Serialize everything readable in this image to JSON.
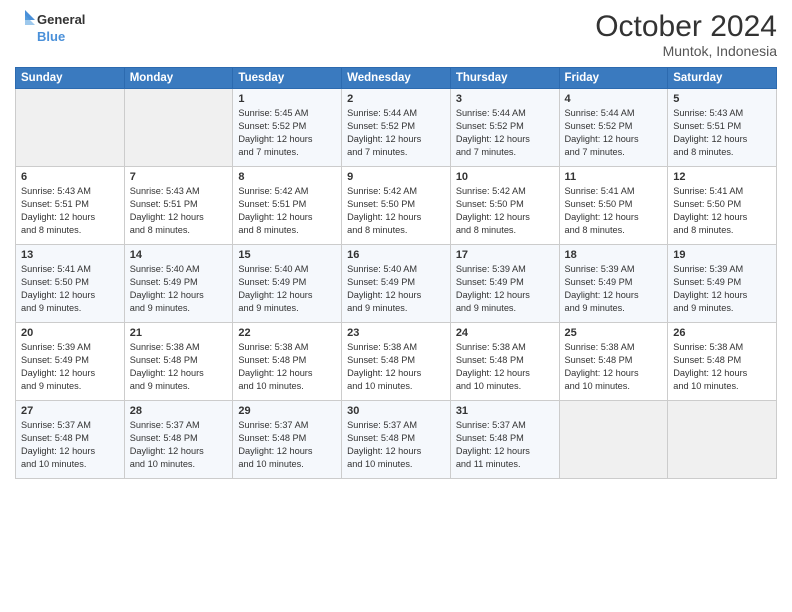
{
  "logo": {
    "line1": "General",
    "line2": "Blue"
  },
  "title": "October 2024",
  "location": "Muntok, Indonesia",
  "days_of_week": [
    "Sunday",
    "Monday",
    "Tuesday",
    "Wednesday",
    "Thursday",
    "Friday",
    "Saturday"
  ],
  "weeks": [
    [
      {
        "day": "",
        "info": ""
      },
      {
        "day": "",
        "info": ""
      },
      {
        "day": "1",
        "info": "Sunrise: 5:45 AM\nSunset: 5:52 PM\nDaylight: 12 hours\nand 7 minutes."
      },
      {
        "day": "2",
        "info": "Sunrise: 5:44 AM\nSunset: 5:52 PM\nDaylight: 12 hours\nand 7 minutes."
      },
      {
        "day": "3",
        "info": "Sunrise: 5:44 AM\nSunset: 5:52 PM\nDaylight: 12 hours\nand 7 minutes."
      },
      {
        "day": "4",
        "info": "Sunrise: 5:44 AM\nSunset: 5:52 PM\nDaylight: 12 hours\nand 7 minutes."
      },
      {
        "day": "5",
        "info": "Sunrise: 5:43 AM\nSunset: 5:51 PM\nDaylight: 12 hours\nand 8 minutes."
      }
    ],
    [
      {
        "day": "6",
        "info": "Sunrise: 5:43 AM\nSunset: 5:51 PM\nDaylight: 12 hours\nand 8 minutes."
      },
      {
        "day": "7",
        "info": "Sunrise: 5:43 AM\nSunset: 5:51 PM\nDaylight: 12 hours\nand 8 minutes."
      },
      {
        "day": "8",
        "info": "Sunrise: 5:42 AM\nSunset: 5:51 PM\nDaylight: 12 hours\nand 8 minutes."
      },
      {
        "day": "9",
        "info": "Sunrise: 5:42 AM\nSunset: 5:50 PM\nDaylight: 12 hours\nand 8 minutes."
      },
      {
        "day": "10",
        "info": "Sunrise: 5:42 AM\nSunset: 5:50 PM\nDaylight: 12 hours\nand 8 minutes."
      },
      {
        "day": "11",
        "info": "Sunrise: 5:41 AM\nSunset: 5:50 PM\nDaylight: 12 hours\nand 8 minutes."
      },
      {
        "day": "12",
        "info": "Sunrise: 5:41 AM\nSunset: 5:50 PM\nDaylight: 12 hours\nand 8 minutes."
      }
    ],
    [
      {
        "day": "13",
        "info": "Sunrise: 5:41 AM\nSunset: 5:50 PM\nDaylight: 12 hours\nand 9 minutes."
      },
      {
        "day": "14",
        "info": "Sunrise: 5:40 AM\nSunset: 5:49 PM\nDaylight: 12 hours\nand 9 minutes."
      },
      {
        "day": "15",
        "info": "Sunrise: 5:40 AM\nSunset: 5:49 PM\nDaylight: 12 hours\nand 9 minutes."
      },
      {
        "day": "16",
        "info": "Sunrise: 5:40 AM\nSunset: 5:49 PM\nDaylight: 12 hours\nand 9 minutes."
      },
      {
        "day": "17",
        "info": "Sunrise: 5:39 AM\nSunset: 5:49 PM\nDaylight: 12 hours\nand 9 minutes."
      },
      {
        "day": "18",
        "info": "Sunrise: 5:39 AM\nSunset: 5:49 PM\nDaylight: 12 hours\nand 9 minutes."
      },
      {
        "day": "19",
        "info": "Sunrise: 5:39 AM\nSunset: 5:49 PM\nDaylight: 12 hours\nand 9 minutes."
      }
    ],
    [
      {
        "day": "20",
        "info": "Sunrise: 5:39 AM\nSunset: 5:49 PM\nDaylight: 12 hours\nand 9 minutes."
      },
      {
        "day": "21",
        "info": "Sunrise: 5:38 AM\nSunset: 5:48 PM\nDaylight: 12 hours\nand 9 minutes."
      },
      {
        "day": "22",
        "info": "Sunrise: 5:38 AM\nSunset: 5:48 PM\nDaylight: 12 hours\nand 10 minutes."
      },
      {
        "day": "23",
        "info": "Sunrise: 5:38 AM\nSunset: 5:48 PM\nDaylight: 12 hours\nand 10 minutes."
      },
      {
        "day": "24",
        "info": "Sunrise: 5:38 AM\nSunset: 5:48 PM\nDaylight: 12 hours\nand 10 minutes."
      },
      {
        "day": "25",
        "info": "Sunrise: 5:38 AM\nSunset: 5:48 PM\nDaylight: 12 hours\nand 10 minutes."
      },
      {
        "day": "26",
        "info": "Sunrise: 5:38 AM\nSunset: 5:48 PM\nDaylight: 12 hours\nand 10 minutes."
      }
    ],
    [
      {
        "day": "27",
        "info": "Sunrise: 5:37 AM\nSunset: 5:48 PM\nDaylight: 12 hours\nand 10 minutes."
      },
      {
        "day": "28",
        "info": "Sunrise: 5:37 AM\nSunset: 5:48 PM\nDaylight: 12 hours\nand 10 minutes."
      },
      {
        "day": "29",
        "info": "Sunrise: 5:37 AM\nSunset: 5:48 PM\nDaylight: 12 hours\nand 10 minutes."
      },
      {
        "day": "30",
        "info": "Sunrise: 5:37 AM\nSunset: 5:48 PM\nDaylight: 12 hours\nand 10 minutes."
      },
      {
        "day": "31",
        "info": "Sunrise: 5:37 AM\nSunset: 5:48 PM\nDaylight: 12 hours\nand 11 minutes."
      },
      {
        "day": "",
        "info": ""
      },
      {
        "day": "",
        "info": ""
      }
    ]
  ]
}
